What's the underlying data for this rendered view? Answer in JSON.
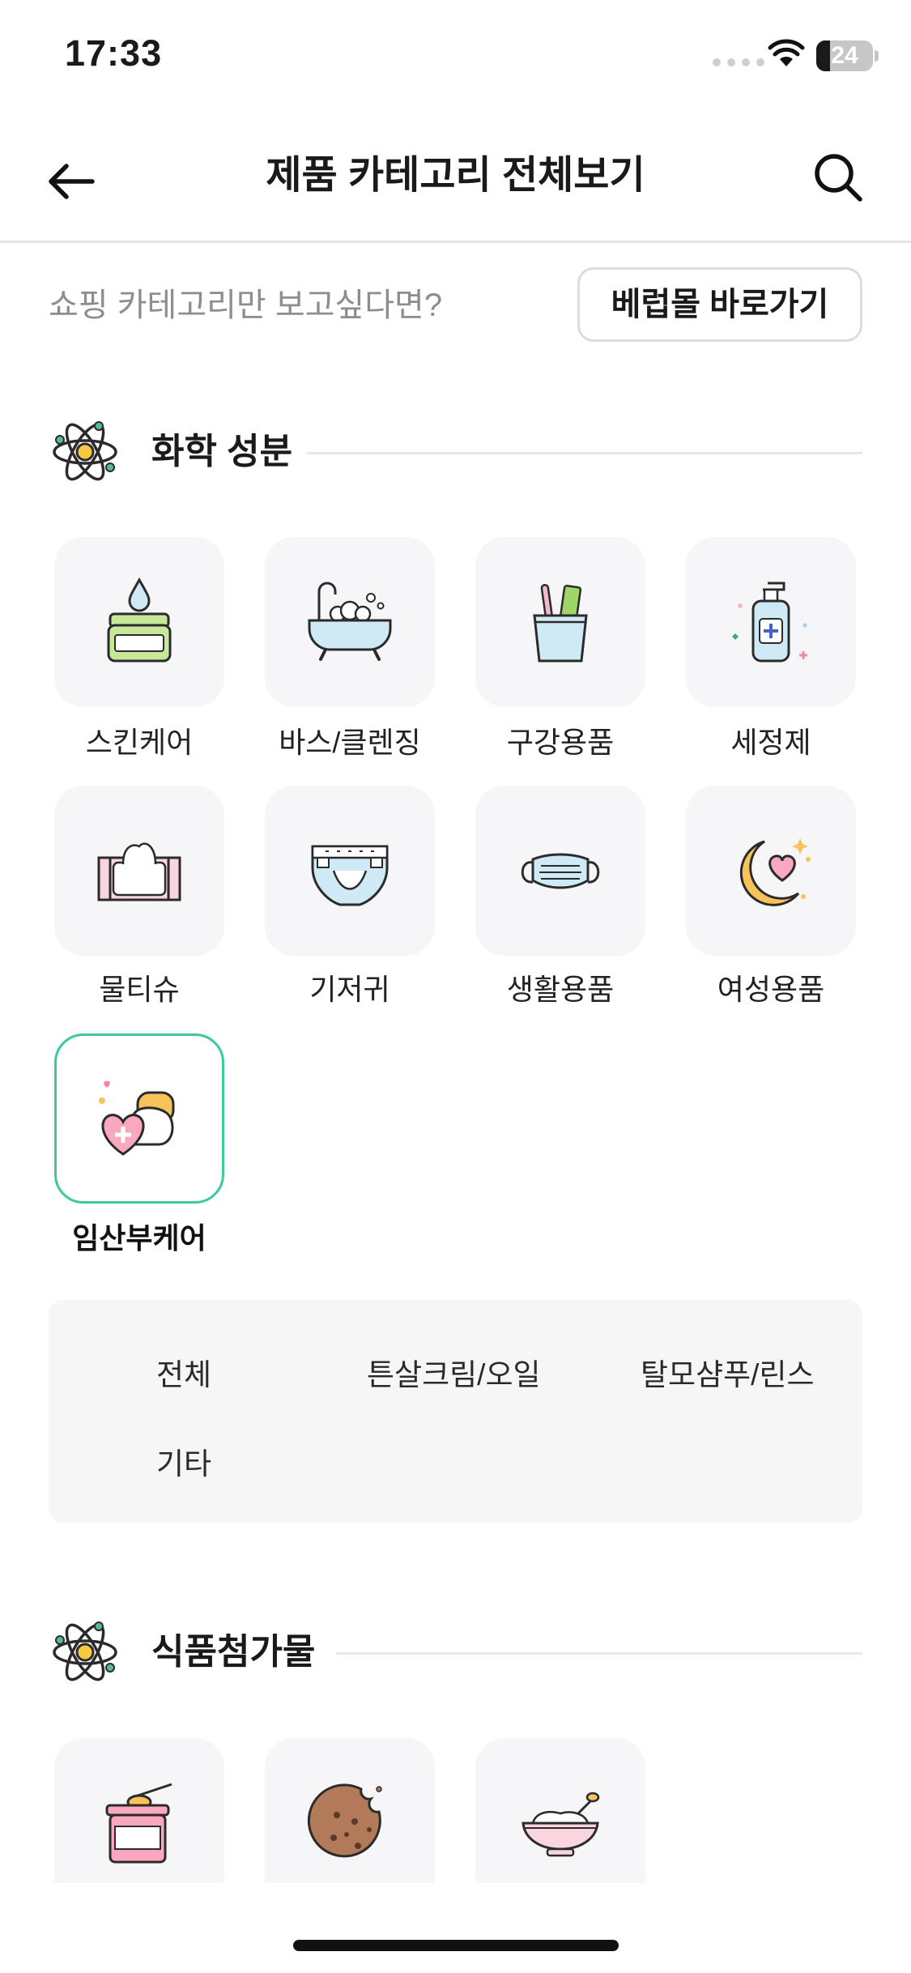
{
  "status_bar": {
    "time": "17:33",
    "battery_level": "24",
    "battery_fraction": 0.24
  },
  "header": {
    "title": "제품 카테고리 전체보기",
    "back_icon": "arrow-left-icon",
    "search_icon": "magnifier-icon"
  },
  "shopping": {
    "prompt": "쇼핑 카테고리만 보고싶다면?",
    "button_label": "베럽몰 바로가기"
  },
  "sections": [
    {
      "title": "화학 성분",
      "icon": "atom-icon",
      "categories": [
        {
          "label": "스킨케어",
          "icon": "cream-jar-icon"
        },
        {
          "label": "바스/클렌징",
          "icon": "bathtub-icon"
        },
        {
          "label": "구강용품",
          "icon": "toothbrush-cup-icon"
        },
        {
          "label": "세정제",
          "icon": "pump-bottle-icon"
        },
        {
          "label": "물티슈",
          "icon": "wet-wipes-icon"
        },
        {
          "label": "기저귀",
          "icon": "diaper-icon"
        },
        {
          "label": "생활용품",
          "icon": "face-mask-icon"
        },
        {
          "label": "여성용품",
          "icon": "moon-heart-icon"
        },
        {
          "label": "임산부케어",
          "icon": "heart-care-icon",
          "selected": true
        }
      ],
      "subcategories": [
        "전체",
        "튼살크림/오일",
        "탈모샴푸/린스",
        "기타"
      ]
    },
    {
      "title": "식품첨가물",
      "icon": "atom-icon",
      "categories": [
        {
          "label": "",
          "icon": "formula-jar-icon"
        },
        {
          "label": "",
          "icon": "cookie-icon"
        },
        {
          "label": "",
          "icon": "baby-food-bowl-icon"
        }
      ]
    }
  ],
  "colors": {
    "accent": "#3cc8a1",
    "tile_bg": "#f6f6f8",
    "muted_text": "#8d8d8d"
  }
}
